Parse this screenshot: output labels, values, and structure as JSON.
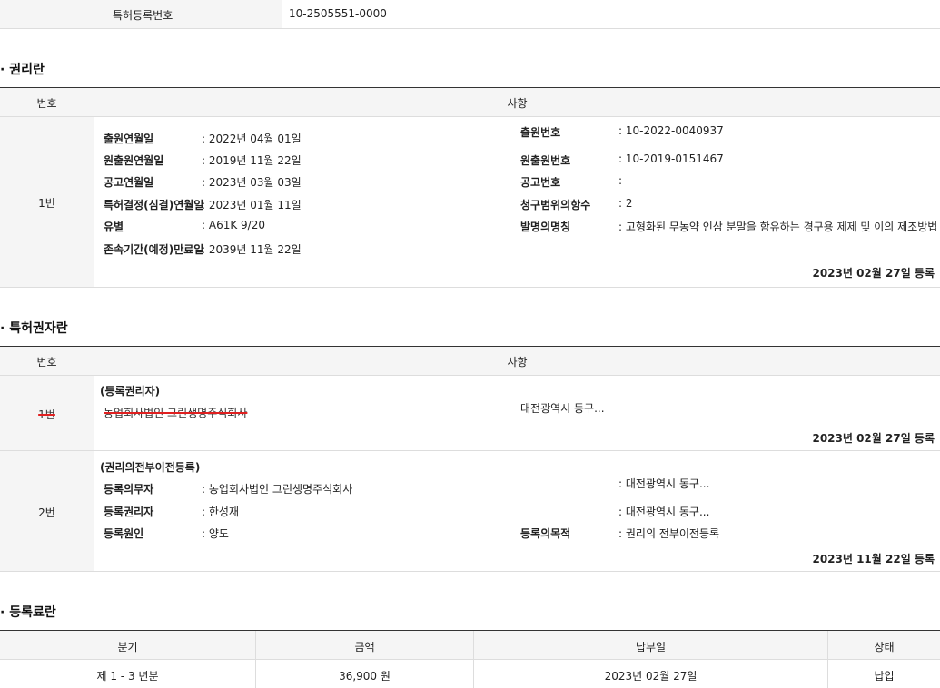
{
  "top_row": {
    "label": "특허등록번호",
    "value": "10-2505551-0000"
  },
  "rights": {
    "title": "· 권리란",
    "header": {
      "no": "번호",
      "content": "사항"
    },
    "row": {
      "no": "1번",
      "left": [
        {
          "label": "출원연월일",
          "value": ": 2022년 04월 01일"
        },
        {
          "label": "원출원연월일",
          "value": ": 2019년 11월 22일"
        },
        {
          "label": "공고연월일",
          "value": ": 2023년 03월 03일"
        },
        {
          "label": "특허결정(심결)연월일",
          "value": ": 2023년 01월 11일"
        },
        {
          "label": "유별",
          "value": ": A61K 9/20"
        },
        {
          "label": "존속기간(예정)만료일",
          "value": ": 2039년 11월 22일"
        }
      ],
      "right": [
        {
          "label": "출원번호",
          "value": ": 10-2022-0040937"
        },
        {
          "label": "원출원번호",
          "value": ": 10-2019-0151467"
        },
        {
          "label": "공고번호",
          "value": ":"
        },
        {
          "label": "청구범위의항수",
          "value": ": 2"
        },
        {
          "label": "발명의명칭",
          "value": ": 고형화된 무농약 인삼 분말을 함유하는 경구용 제제 및 이의 제조방법"
        }
      ],
      "date": "2023년 02월 27일 등록"
    }
  },
  "patentee": {
    "title": "· 특허권자란",
    "header": {
      "no": "번호",
      "content": "사항"
    },
    "row1": {
      "no": "1번",
      "type": "(등록권리자)",
      "name": "농업회사법인 그린생명주식회사",
      "address": "대전광역시 동구...",
      "date": "2023년 02월 27일 등록"
    },
    "row2": {
      "no": "2번",
      "type": "(권리의전부이전등록)",
      "left": [
        {
          "label": "등록의무자",
          "value": ": 농업회사법인 그린생명주식회사"
        },
        {
          "label": "등록권리자",
          "value": ": 한성재"
        },
        {
          "label": "등록원인",
          "value": ": 양도"
        }
      ],
      "addr1": ": 대전광역시 동구...",
      "addr2": ": 대전광역시 동구...",
      "purpose_label": "등록의목적",
      "purpose_value": ": 권리의 전부이전등록",
      "date": "2023년 11월 22일 등록"
    }
  },
  "fees": {
    "title": "· 등록료란",
    "headers": [
      "분기",
      "금액",
      "납부일",
      "상태"
    ],
    "rows": [
      [
        "제 1 - 3 년분",
        "36,900 원",
        "2023년 02월 27일",
        "납입"
      ]
    ]
  },
  "colors": {
    "strike": "#e02020",
    "header_bg": "#f5f5f5",
    "border_dark": "#333333"
  }
}
